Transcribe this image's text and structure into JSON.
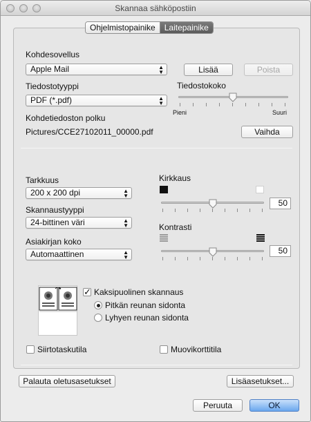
{
  "window": {
    "title": "Skannaa sähköpostiin"
  },
  "tabs": {
    "software_button": "Ohjelmistopainike",
    "device_button": "Laitepainike"
  },
  "target": {
    "label": "Kohdesovellus",
    "app_value": "Apple Mail",
    "add_button": "Lisää",
    "remove_button": "Poista"
  },
  "file_type": {
    "label": "Tiedostotyyppi",
    "value": "PDF (*.pdf)"
  },
  "file_size": {
    "label": "Tiedostokoko",
    "min_label": "Pieni",
    "max_label": "Suuri",
    "level": 0.5
  },
  "path": {
    "label": "Kohdetiedoston polku",
    "value": "Pictures/CCE27102011_00000.pdf",
    "change_button": "Vaihda"
  },
  "resolution": {
    "label": "Tarkkuus",
    "value": "200 x 200 dpi"
  },
  "scan_type": {
    "label": "Skannaustyyppi",
    "value": "24-bittinen väri"
  },
  "doc_size": {
    "label": "Asiakirjan koko",
    "value": "Automaattinen"
  },
  "brightness": {
    "label": "Kirkkaus",
    "value": "50",
    "level": 0.5
  },
  "contrast": {
    "label": "Kontrasti",
    "value": "50",
    "level": 0.5
  },
  "duplex": {
    "label": "Kaksipuolinen skannaus",
    "checked": true,
    "long_edge": "Pitkän reunan sidonta",
    "short_edge": "Lyhyen reunan sidonta"
  },
  "carrier_sheet": {
    "label": "Siirtotaskutila"
  },
  "plastic_card": {
    "label": "Muovikorttitila"
  },
  "footer": {
    "restore_defaults": "Palauta oletusasetukset",
    "advanced": "Lisäasetukset...",
    "cancel": "Peruuta",
    "ok": "OK"
  }
}
